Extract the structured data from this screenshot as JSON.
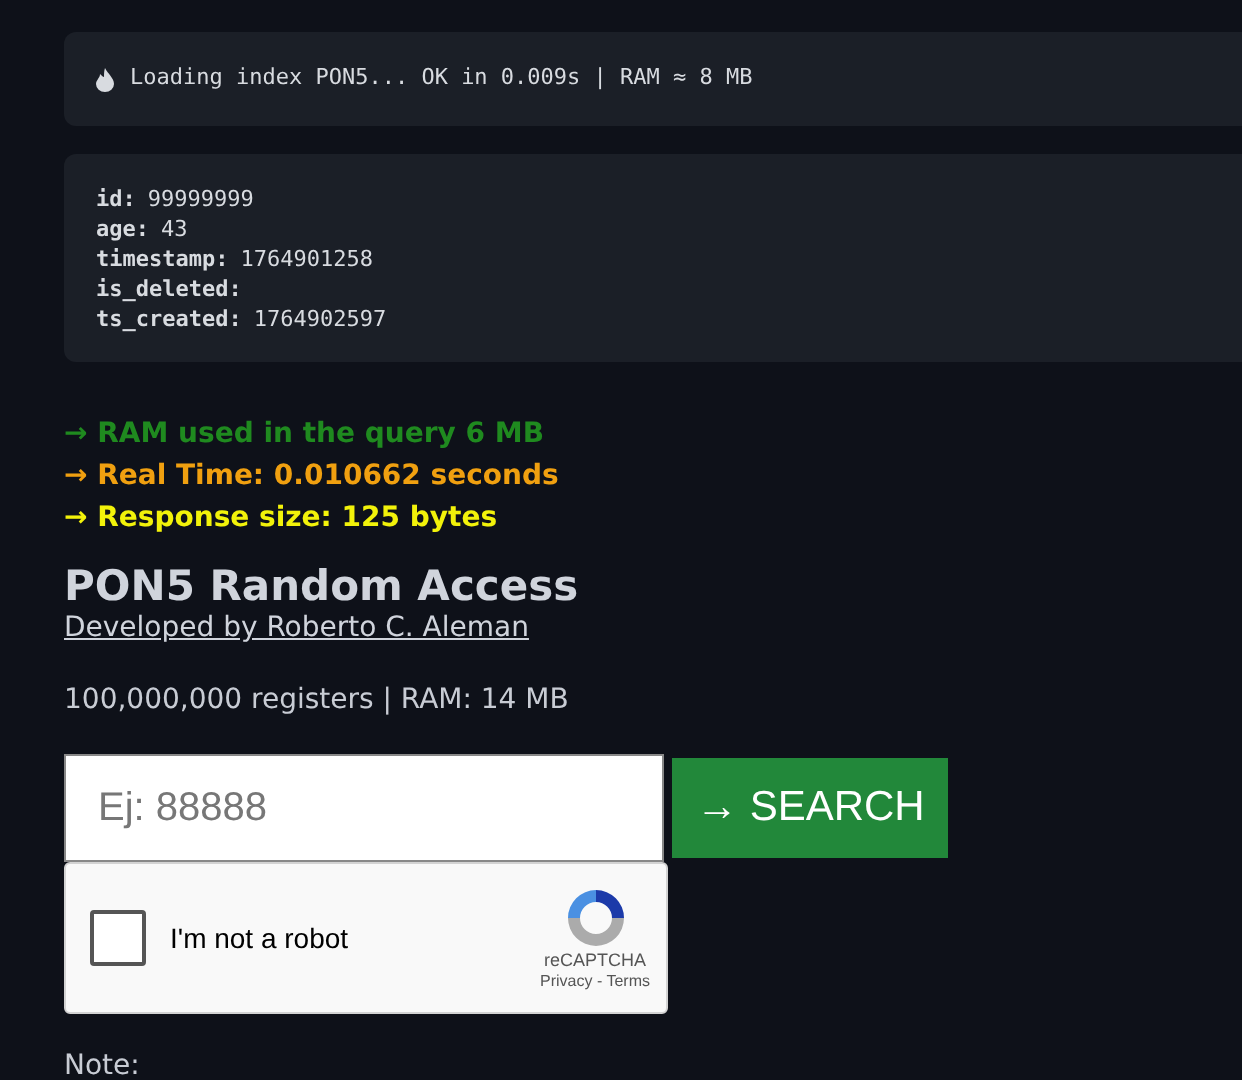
{
  "log": {
    "text": "Loading index PON5... OK in 0.009s | RAM ≈ 8 MB"
  },
  "record": [
    {
      "key": "id:",
      "value": "99999999"
    },
    {
      "key": "age:",
      "value": "43"
    },
    {
      "key": "timestamp:",
      "value": "1764901258"
    },
    {
      "key": "is_deleted:"
    },
    {
      "key": "ts_created:",
      "value": "1764902597"
    }
  ],
  "metrics": [
    {
      "arrow": "→",
      "text": "RAM used in the query 6 MB",
      "color": "#1f8a1f"
    },
    {
      "arrow": "→",
      "text": "Real Time: 0.010662 seconds",
      "color": "#f0a010"
    },
    {
      "arrow": "→",
      "text": "Response size: 125 bytes",
      "color": "#f2f20a"
    }
  ],
  "title": "PON5 Random Access",
  "author_link": "Developed by Roberto C. Aleman",
  "stats": "100,000,000 registers | RAM: 14 MB",
  "search": {
    "placeholder": "Ej: 88888",
    "button": "→ SEARCH"
  },
  "captcha": {
    "label": "I'm not a robot",
    "checked": false,
    "brand": "reCAPTCHA",
    "links": "Privacy - Terms"
  },
  "note": "Note:"
}
